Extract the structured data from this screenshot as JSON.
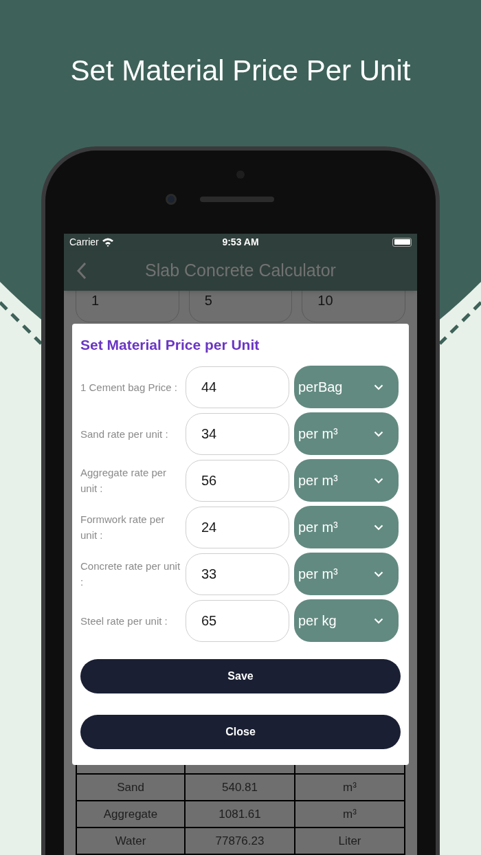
{
  "headline": "Set Material Price Per Unit",
  "status_bar": {
    "carrier": "Carrier",
    "time": "9:53 AM"
  },
  "app_bar": {
    "title": "Slab Concrete Calculator"
  },
  "ratio_fields": [
    "1",
    "5",
    "10"
  ],
  "dialog": {
    "title": "Set Material Price per Unit",
    "rows": [
      {
        "label": "1 Cement bag Price :",
        "value": "44",
        "unit": "perBag"
      },
      {
        "label": "Sand rate per unit :",
        "value": "34",
        "unit": "per m³"
      },
      {
        "label": "Aggregate rate per unit :",
        "value": "56",
        "unit": "per m³"
      },
      {
        "label": "Formwork rate per unit :",
        "value": "24",
        "unit": "per m³"
      },
      {
        "label": "Concrete rate per unit :",
        "value": "33",
        "unit": "per m³"
      },
      {
        "label": "Steel rate per unit :",
        "value": "65",
        "unit": "per kg"
      }
    ],
    "buttons": [
      "Save",
      "Close"
    ]
  },
  "table": {
    "rows": [
      {
        "material": "Sand",
        "quantity": "540.81",
        "unit": "m³"
      },
      {
        "material": "Aggregate",
        "quantity": "1081.61",
        "unit": "m³"
      },
      {
        "material": "Water",
        "quantity": "77876.23",
        "unit": "Liter"
      }
    ]
  }
}
